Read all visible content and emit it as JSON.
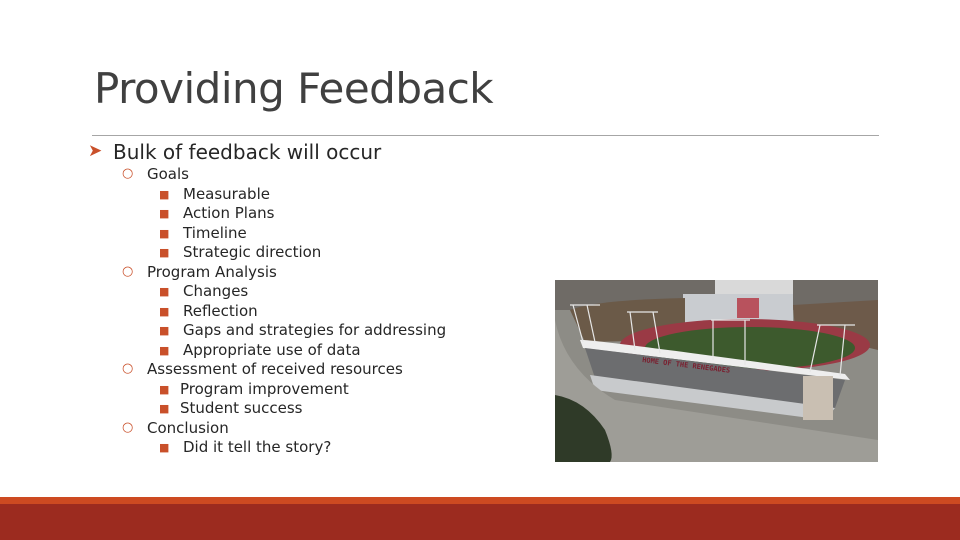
{
  "slide": {
    "title": "Providing Feedback",
    "main_bullet": "Bulk of feedback will occur",
    "main_bullet_marker": "arrow-bullet-icon",
    "items": [
      {
        "level": 1,
        "text": "Goals"
      },
      {
        "level": 2,
        "text": "Measurable"
      },
      {
        "level": 2,
        "text": "Action Plans"
      },
      {
        "level": 2,
        "text": "Timeline"
      },
      {
        "level": 2,
        "text": "Strategic direction"
      },
      {
        "level": 1,
        "text": "Program Analysis"
      },
      {
        "level": 2,
        "text": "Changes"
      },
      {
        "level": 2,
        "text": "Reflection"
      },
      {
        "level": 2,
        "text": "Gaps and strategies for addressing"
      },
      {
        "level": 2,
        "text": "Appropriate use of data"
      },
      {
        "level": 1,
        "text": "Assessment of received resources"
      },
      {
        "level": 2,
        "text": "Program improvement"
      },
      {
        "level": 2,
        "text": "Student success"
      },
      {
        "level": 1,
        "text": "Conclusion"
      },
      {
        "level": 2,
        "text": "Did it tell the story?"
      }
    ],
    "photo_sign_text": "HOME OF THE RENEGADES"
  },
  "colors": {
    "accent": "#cd4a21",
    "footer": "#9c2b1f",
    "title": "#404040"
  }
}
